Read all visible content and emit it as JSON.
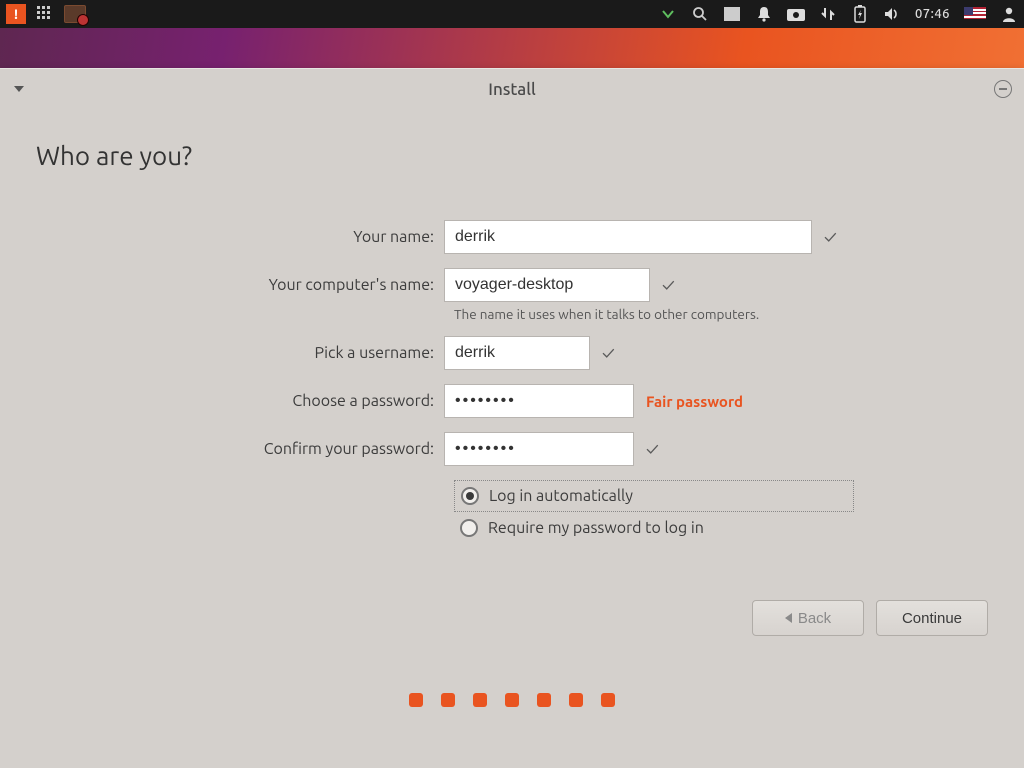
{
  "panel": {
    "clock": "07:46"
  },
  "window": {
    "title": "Install"
  },
  "page": {
    "heading": "Who are you?",
    "fields": {
      "name_label": "Your name:",
      "name_value": "derrik",
      "computer_label": "Your computer's name:",
      "computer_value": "voyager-desktop",
      "computer_helper": "The name it uses when it talks to other computers.",
      "username_label": "Pick a username:",
      "username_value": "derrik",
      "password_label": "Choose a password:",
      "password_value": "••••••••",
      "password_strength": "Fair password",
      "confirm_label": "Confirm your password:",
      "confirm_value": "••••••••"
    },
    "login_options": {
      "auto": "Log in automatically",
      "require": "Require my password to log in",
      "selected": "auto"
    },
    "buttons": {
      "back": "Back",
      "continue": "Continue"
    }
  }
}
